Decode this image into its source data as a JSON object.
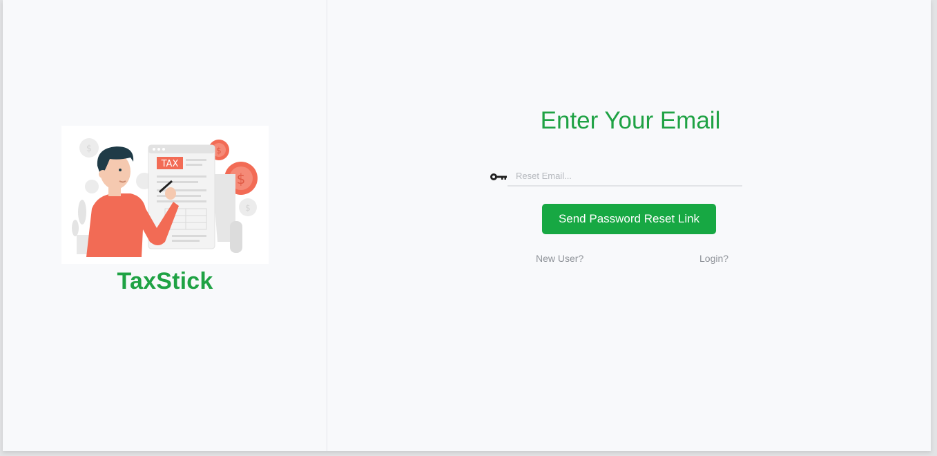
{
  "brand": {
    "name": "TaxStick",
    "illustration_text": "TAX"
  },
  "form": {
    "heading": "Enter Your Email",
    "email_placeholder": "Reset Email...",
    "email_value": "",
    "submit_label": "Send Password Reset Link",
    "new_user_link": "New User?",
    "login_link": "Login?"
  },
  "colors": {
    "brand_green": "#1fa244",
    "button_green": "#17a843",
    "background": "#f8f9fb",
    "illustration_coral": "#f26b55"
  },
  "icons": {
    "email_field_icon": "key-icon"
  }
}
